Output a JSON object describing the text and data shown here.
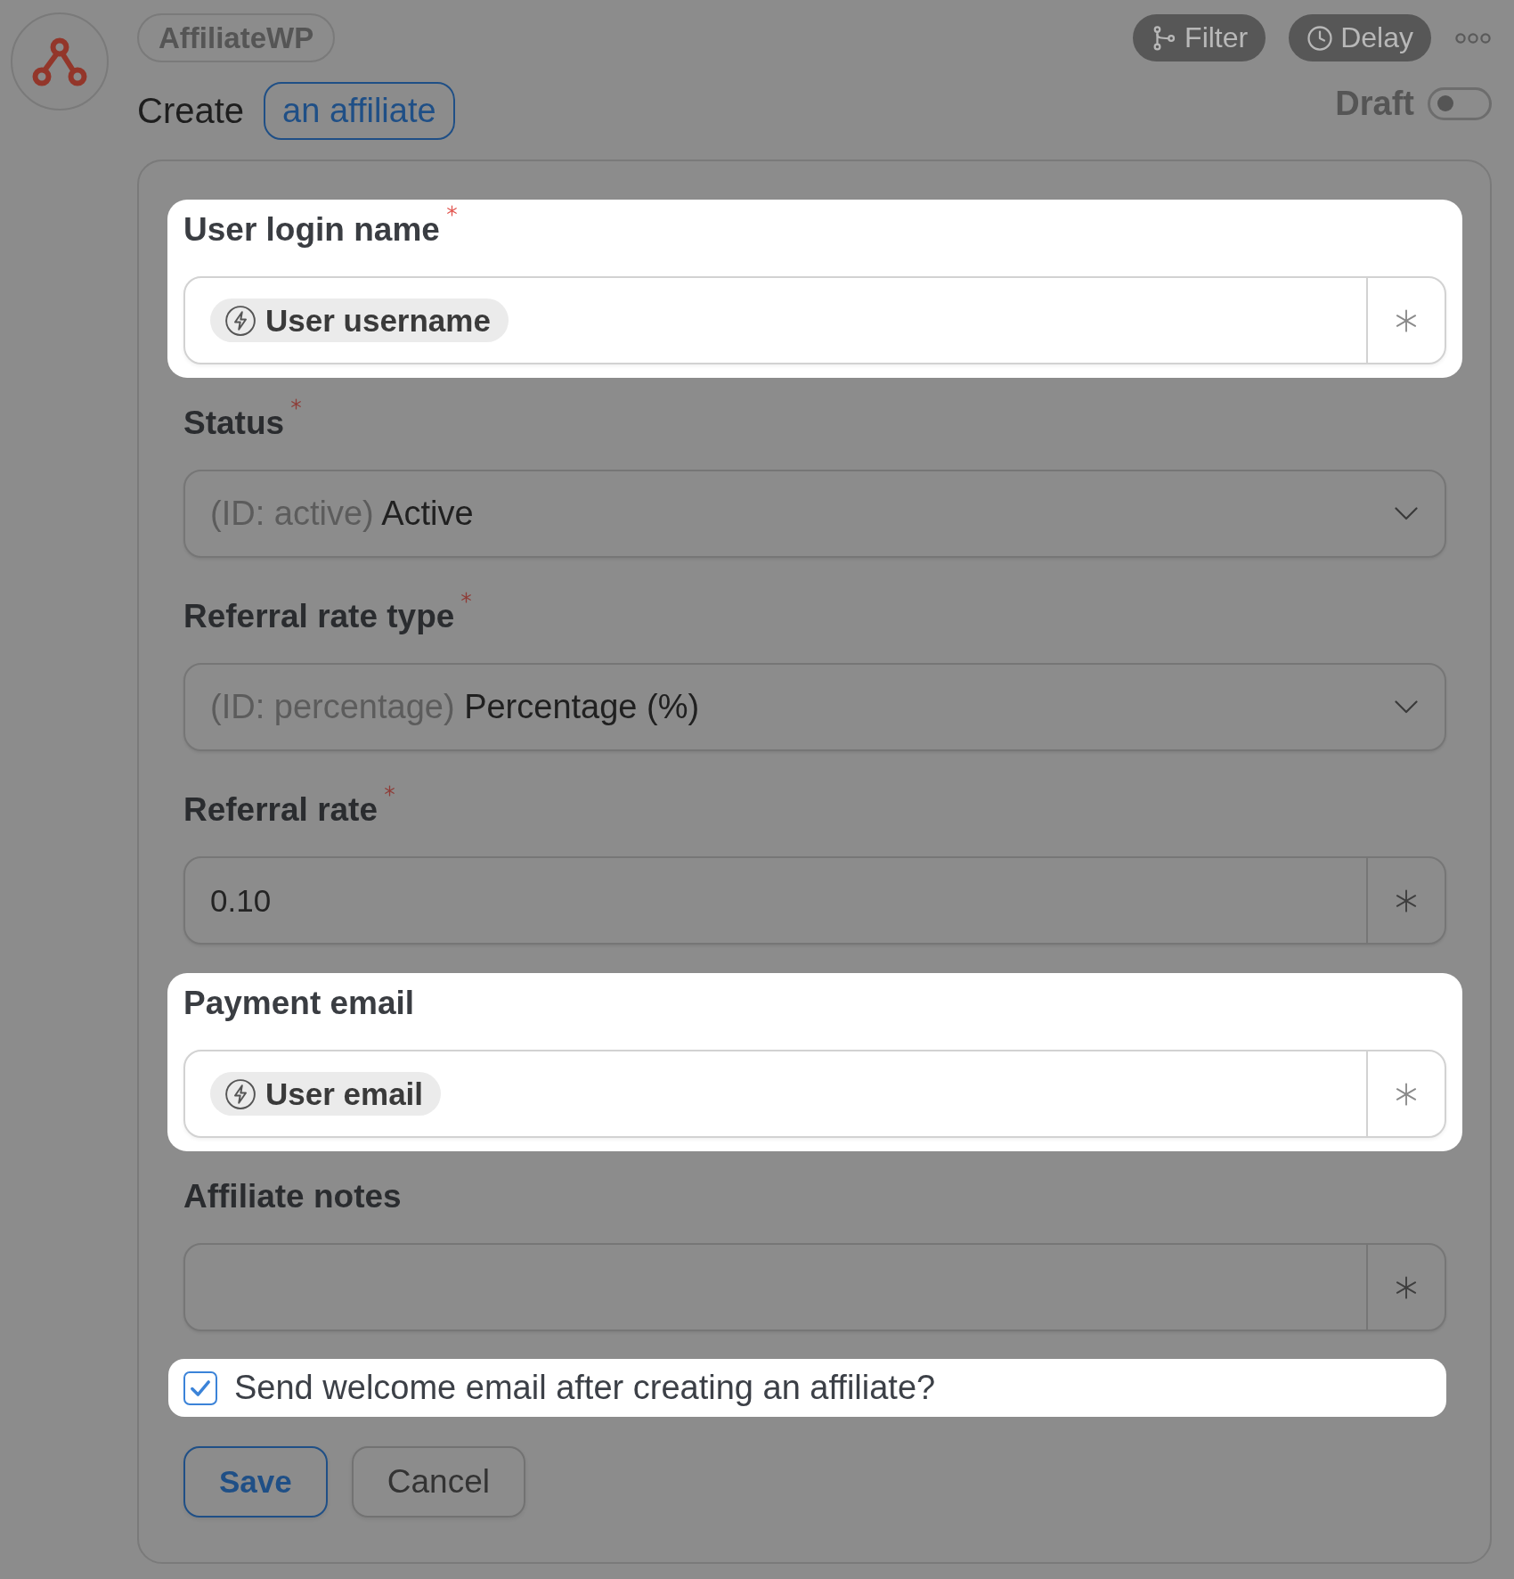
{
  "app": {
    "label": "AffiliateWP"
  },
  "actions": [
    {
      "kind": "filter",
      "label": "Filter"
    },
    {
      "kind": "delay",
      "label": "Delay"
    }
  ],
  "heading": {
    "verb": "Create",
    "object": "an affiliate"
  },
  "draft": {
    "label": "Draft",
    "on": false
  },
  "fields": [
    {
      "kind": "token",
      "label": "User login name",
      "required": true,
      "highlighted": true,
      "token": "User username"
    },
    {
      "kind": "select",
      "label": "Status",
      "required": true,
      "highlighted": false,
      "id_label": "(ID: active)",
      "value": "Active"
    },
    {
      "kind": "select",
      "label": "Referral rate type",
      "required": true,
      "highlighted": false,
      "id_label": "(ID: percentage)",
      "value": "Percentage (%)"
    },
    {
      "kind": "text",
      "label": "Referral rate",
      "required": true,
      "highlighted": false,
      "value": "0.10"
    },
    {
      "kind": "token",
      "label": "Payment email",
      "required": false,
      "highlighted": true,
      "token": "User email"
    },
    {
      "kind": "text",
      "label": "Affiliate notes",
      "required": false,
      "highlighted": false
    }
  ],
  "welcome_email": {
    "label": "Send welcome email after creating an affiliate?",
    "checked": true,
    "highlighted": true
  },
  "buttons": [
    {
      "kind": "primary",
      "label": "Save"
    },
    {
      "kind": "secondary",
      "label": "Cancel"
    }
  ]
}
